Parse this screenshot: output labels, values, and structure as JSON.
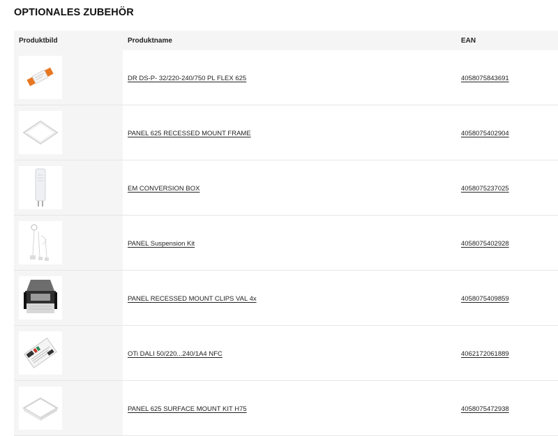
{
  "section": {
    "title": "OPTIONALES ZUBEHÖR"
  },
  "table": {
    "headers": {
      "image": "Produktbild",
      "name": "Produktname",
      "ean": "EAN"
    },
    "rows": [
      {
        "name": "DR DS-P- 32/220-240/750 PL FLEX 625",
        "ean": "4058075843691",
        "icon": "led-driver-icon"
      },
      {
        "name": "PANEL 625 RECESSED MOUNT FRAME",
        "ean": "4058075402904",
        "icon": "recessed-frame-icon"
      },
      {
        "name": "EM CONVERSION BOX",
        "ean": "4058075237025",
        "icon": "conversion-box-icon"
      },
      {
        "name": "PANEL Suspension Kit",
        "ean": "4058075402928",
        "icon": "suspension-kit-icon"
      },
      {
        "name": "PANEL RECESSED MOUNT CLIPS VAL 4x",
        "ean": "4058075409859",
        "icon": "mount-clip-icon"
      },
      {
        "name": "OTi DALI 50/220...240/1A4 NFC",
        "ean": "4062172061889",
        "icon": "dali-driver-icon"
      },
      {
        "name": "PANEL 625 SURFACE MOUNT KIT H75",
        "ean": "4058075472938",
        "icon": "surface-mount-kit-icon"
      }
    ]
  },
  "colors": {
    "accent_orange": "#e87722",
    "header_bg": "#f5f5f5",
    "text": "#222222"
  }
}
